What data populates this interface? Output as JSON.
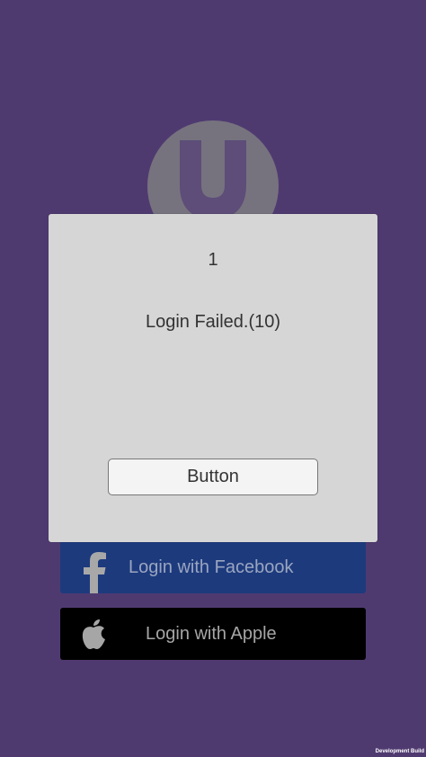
{
  "background_color": "#4f3a70",
  "logo": {
    "icon": "u-logo-icon"
  },
  "facebook_button": {
    "label": "Login with Facebook",
    "icon": "facebook-icon",
    "color": "#1d3a7d"
  },
  "apple_button": {
    "label": "Login with Apple",
    "icon": "apple-icon",
    "color": "#000000"
  },
  "dialog": {
    "title": "1",
    "message": "Login Failed.(10)",
    "button_label": "Button"
  },
  "watermark": {
    "text": "Development Build"
  }
}
